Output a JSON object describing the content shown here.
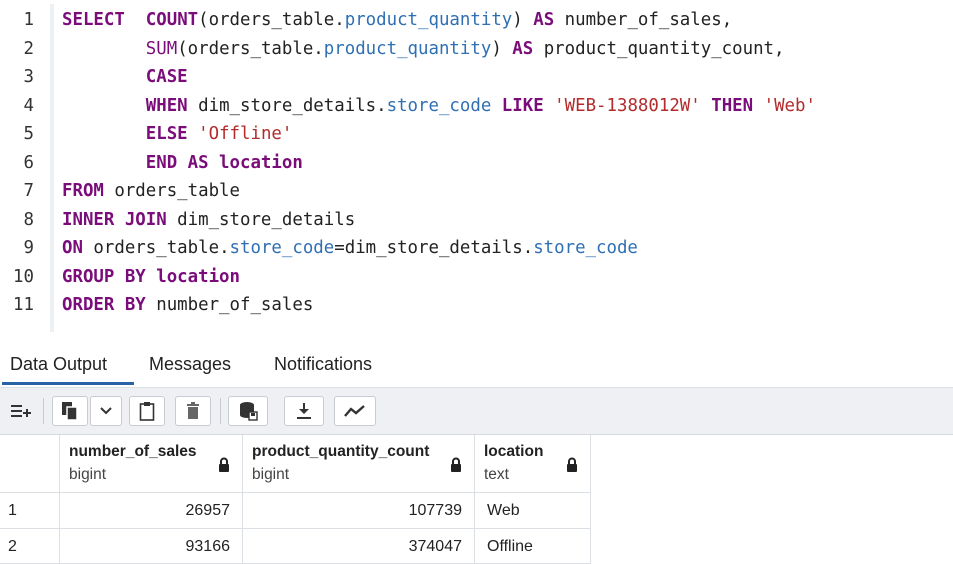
{
  "editor": {
    "lines": [
      {
        "n": "1",
        "tokens": [
          {
            "t": "SELECT",
            "c": "kw"
          },
          {
            "t": "  ",
            "c": "plain"
          },
          {
            "t": "COUNT",
            "c": "kw"
          },
          {
            "t": "(orders_table.",
            "c": "plain"
          },
          {
            "t": "product_quantity",
            "c": "prop"
          },
          {
            "t": ") ",
            "c": "plain"
          },
          {
            "t": "AS",
            "c": "kw"
          },
          {
            "t": " number_of_sales,",
            "c": "plain"
          }
        ]
      },
      {
        "n": "2",
        "tokens": [
          {
            "t": "        ",
            "c": "plain"
          },
          {
            "t": "SUM",
            "c": "fn"
          },
          {
            "t": "(orders_table.",
            "c": "plain"
          },
          {
            "t": "product_quantity",
            "c": "prop"
          },
          {
            "t": ") ",
            "c": "plain"
          },
          {
            "t": "AS",
            "c": "kw"
          },
          {
            "t": " product_quantity_count,",
            "c": "plain"
          }
        ]
      },
      {
        "n": "3",
        "tokens": [
          {
            "t": "        ",
            "c": "plain"
          },
          {
            "t": "CASE",
            "c": "kw"
          }
        ]
      },
      {
        "n": "4",
        "tokens": [
          {
            "t": "        ",
            "c": "plain"
          },
          {
            "t": "WHEN",
            "c": "kw"
          },
          {
            "t": " dim_store_details.",
            "c": "plain"
          },
          {
            "t": "store_code",
            "c": "prop"
          },
          {
            "t": " ",
            "c": "plain"
          },
          {
            "t": "LIKE",
            "c": "kw"
          },
          {
            "t": " ",
            "c": "plain"
          },
          {
            "t": "'WEB-1388012W'",
            "c": "str"
          },
          {
            "t": " ",
            "c": "plain"
          },
          {
            "t": "THEN",
            "c": "kw"
          },
          {
            "t": " ",
            "c": "plain"
          },
          {
            "t": "'Web'",
            "c": "str"
          }
        ]
      },
      {
        "n": "5",
        "tokens": [
          {
            "t": "        ",
            "c": "plain"
          },
          {
            "t": "ELSE",
            "c": "kw"
          },
          {
            "t": " ",
            "c": "plain"
          },
          {
            "t": "'Offline'",
            "c": "str"
          }
        ]
      },
      {
        "n": "6",
        "tokens": [
          {
            "t": "        ",
            "c": "plain"
          },
          {
            "t": "END AS location",
            "c": "kw"
          }
        ]
      },
      {
        "n": "7",
        "tokens": [
          {
            "t": "FROM",
            "c": "kw"
          },
          {
            "t": " orders_table",
            "c": "plain"
          }
        ]
      },
      {
        "n": "8",
        "tokens": [
          {
            "t": "INNER JOIN",
            "c": "kw"
          },
          {
            "t": " dim_store_details",
            "c": "plain"
          }
        ]
      },
      {
        "n": "9",
        "tokens": [
          {
            "t": "ON",
            "c": "kw"
          },
          {
            "t": " orders_table.",
            "c": "plain"
          },
          {
            "t": "store_code",
            "c": "prop"
          },
          {
            "t": "=dim_store_details.",
            "c": "plain"
          },
          {
            "t": "store_code",
            "c": "prop"
          }
        ]
      },
      {
        "n": "10",
        "tokens": [
          {
            "t": "GROUP BY location",
            "c": "kw"
          }
        ]
      },
      {
        "n": "11",
        "tokens": [
          {
            "t": "ORDER BY",
            "c": "kw"
          },
          {
            "t": " number_of_sales",
            "c": "plain"
          }
        ]
      }
    ]
  },
  "tabs": [
    {
      "label": "Data Output",
      "active": true
    },
    {
      "label": "Messages",
      "active": false
    },
    {
      "label": "Notifications",
      "active": false
    }
  ],
  "toolbar": {
    "icons": [
      "add-row-icon",
      "copy-icon",
      "chevron-down-icon",
      "paste-icon",
      "delete-icon",
      "save-data-icon",
      "download-icon",
      "graph-icon"
    ]
  },
  "grid": {
    "columns": [
      {
        "name": "number_of_sales",
        "type": "bigint"
      },
      {
        "name": "product_quantity_count",
        "type": "bigint"
      },
      {
        "name": "location",
        "type": "text"
      }
    ],
    "rows": [
      {
        "num": "1",
        "cells": [
          "26957",
          "107739",
          "Web"
        ]
      },
      {
        "num": "2",
        "cells": [
          "93166",
          "374047",
          "Offline"
        ]
      }
    ]
  },
  "colors": {
    "keyword": "#7a0d7a",
    "property": "#2f6fb3",
    "string": "#b32b2b",
    "active_tab": "#2a62a8"
  }
}
